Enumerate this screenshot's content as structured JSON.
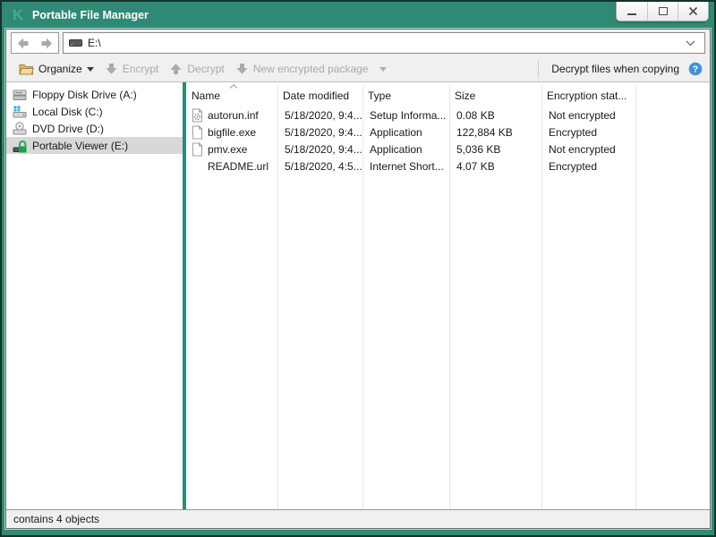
{
  "window": {
    "title": "Portable File Manager"
  },
  "navbar": {
    "address": "E:\\"
  },
  "toolbar": {
    "organize_label": "Organize",
    "encrypt_label": "Encrypt",
    "decrypt_label": "Decrypt",
    "new_package_label": "New encrypted package",
    "decrypt_copy_label": "Decrypt files when copying"
  },
  "sidebar": {
    "items": [
      {
        "label": "Floppy Disk Drive (A:)",
        "icon": "floppy-drive-icon",
        "state": ""
      },
      {
        "label": "Local Disk (C:)",
        "icon": "local-disk-icon",
        "state": ""
      },
      {
        "label": "DVD Drive (D:)",
        "icon": "dvd-drive-icon",
        "state": ""
      },
      {
        "label": "Portable Viewer (E:)",
        "icon": "locked-drive-icon",
        "state": "selected"
      }
    ]
  },
  "filelist": {
    "columns": [
      {
        "label": "Name",
        "state": "sorted"
      },
      {
        "label": "Date modified",
        "state": ""
      },
      {
        "label": "Type",
        "state": ""
      },
      {
        "label": "Size",
        "state": ""
      },
      {
        "label": "Encryption stat...",
        "state": ""
      },
      {
        "label": "",
        "state": ""
      }
    ],
    "rows": [
      {
        "name": "autorun.inf",
        "date": "5/18/2020, 9:4...",
        "type": "Setup Informa...",
        "size": "0.08 KB",
        "status": "Not encrypted",
        "icon": "setup-file-icon"
      },
      {
        "name": "bigfile.exe",
        "date": "5/18/2020, 9:4...",
        "type": "Application",
        "size": "122,884 KB",
        "status": "Encrypted",
        "icon": "file-icon"
      },
      {
        "name": "pmv.exe",
        "date": "5/18/2020, 9:4...",
        "type": "Application",
        "size": "5,036 KB",
        "status": "Not encrypted",
        "icon": "file-icon"
      },
      {
        "name": "README.url",
        "date": "5/18/2020, 4:5...",
        "type": "Internet Short...",
        "size": "4.07 KB",
        "status": "Encrypted",
        "icon": "blank-icon"
      }
    ]
  },
  "statusbar": {
    "text": "contains 4 objects"
  },
  "colors": {
    "brand_teal": "#2e8a74",
    "help_blue": "#4191d9",
    "lock_green": "#1ca24a",
    "disabled_gray": "#a9a9a9",
    "selection_gray": "#d8d8d8"
  }
}
